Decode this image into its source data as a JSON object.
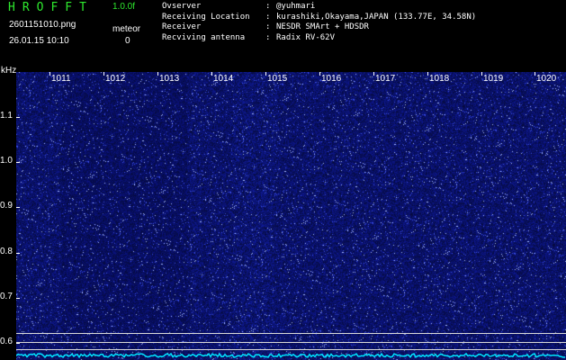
{
  "header": {
    "app_title": "HROFFT",
    "version": "1.0.0f",
    "filename": "2601151010.png",
    "timestamp": "26.01.15 10:10",
    "meteor_label": "meteor",
    "meteor_count": "0"
  },
  "info": [
    {
      "key": "Ovserver",
      "sep": ":",
      "value": "@yuhmari"
    },
    {
      "key": "Receiving Location",
      "sep": ":",
      "value": "kurashiki,Okayama,JAPAN (133.77E, 34.58N)"
    },
    {
      "key": "Receiver",
      "sep": ":",
      "value": "NESDR SMArt + HDSDR"
    },
    {
      "key": "Recviving antenna",
      "sep": ":",
      "value": "Radix RV-62V"
    }
  ],
  "axis": {
    "unit": "kHz",
    "x_ticks": [
      "1011",
      "1012",
      "1013",
      "1014",
      "1015",
      "1016",
      "1017",
      "1018",
      "1019",
      "1020"
    ],
    "y_ticks": [
      "1.1",
      "1.0",
      "0.9",
      "0.8",
      "0.7",
      "0.6"
    ]
  },
  "colors": {
    "background": "#000000",
    "title_green": "#2ee82e",
    "plot_blue": "#05054e",
    "noise_blue": "#2a3cff",
    "trace_cyan": "#00e5ff"
  }
}
